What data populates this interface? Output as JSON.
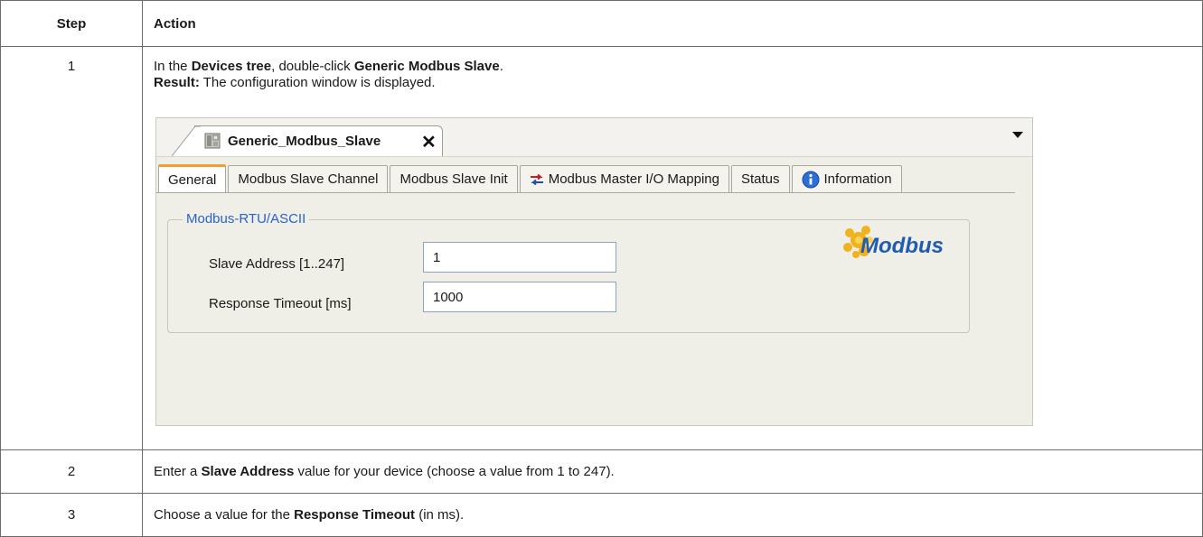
{
  "table": {
    "headers": {
      "step": "Step",
      "action": "Action"
    },
    "rows": [
      {
        "step": "1",
        "line1": {
          "pre": "In the ",
          "b1": "Devices tree",
          "mid": ", double-click ",
          "b2": "Generic Modbus Slave",
          "post": "."
        },
        "line2": {
          "b": "Result:",
          "post": " The configuration window is displayed."
        }
      },
      {
        "step": "2",
        "text": {
          "pre": "Enter a ",
          "b": "Slave Address",
          "post": " value for your device (choose a value from 1 to 247)."
        }
      },
      {
        "step": "3",
        "text": {
          "pre": "Choose a value for the ",
          "b": "Response Timeout",
          "post": " (in ms)."
        }
      }
    ]
  },
  "screenshot": {
    "doc_tab": {
      "title": "Generic_Modbus_Slave",
      "close_icon": "close-icon"
    },
    "subtabs": [
      {
        "label": "General",
        "active": true
      },
      {
        "label": "Modbus Slave Channel"
      },
      {
        "label": "Modbus Slave Init"
      },
      {
        "label": "Modbus Master I/O Mapping",
        "icon": "io-mapping-icon"
      },
      {
        "label": "Status"
      },
      {
        "label": "Information",
        "icon": "info-icon"
      }
    ],
    "group": {
      "legend": "Modbus-RTU/ASCII",
      "slave_address": {
        "label": "Slave Address [1..247]",
        "value": "1"
      },
      "response_timeout": {
        "label": "Response Timeout [ms]",
        "value": "1000"
      }
    },
    "logo": {
      "text": "Modbus",
      "color": "#1f5bb0"
    }
  }
}
